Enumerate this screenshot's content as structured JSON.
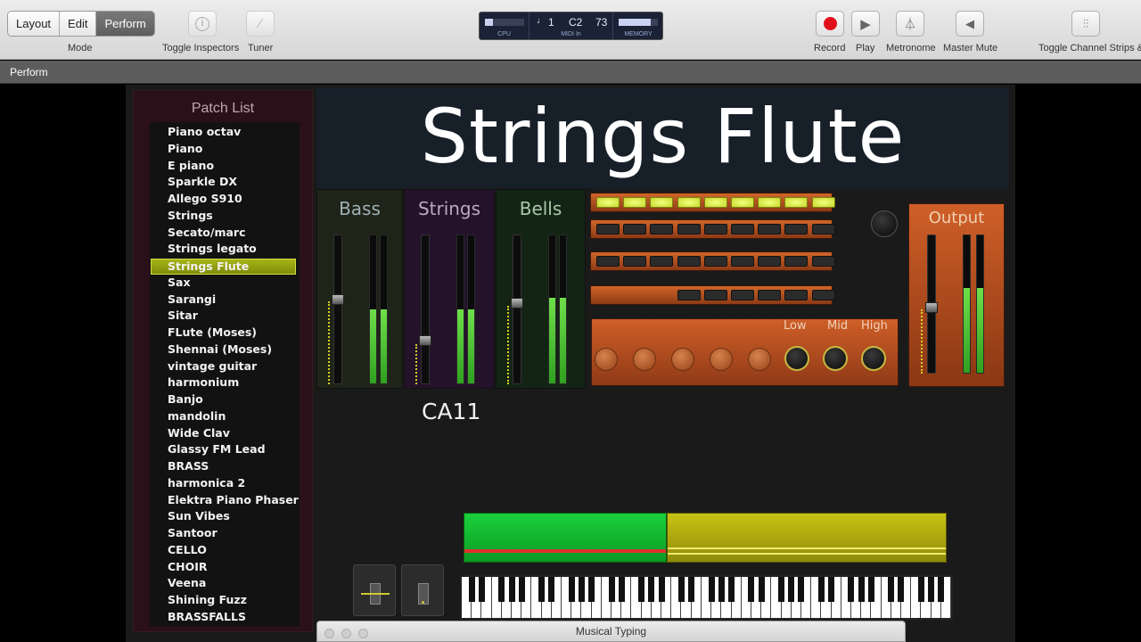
{
  "toolbar": {
    "mode_tabs": [
      "Layout",
      "Edit",
      "Perform"
    ],
    "active_mode": "Perform",
    "mode_label": "Mode",
    "toggle_inspectors_label": "Toggle Inspectors",
    "tuner_label": "Tuner",
    "record_label": "Record",
    "play_label": "Play",
    "metronome_label": "Metronome",
    "master_mute_label": "Master Mute",
    "toggle_channel_strips_label": "Toggle Channel Strips &"
  },
  "lcd": {
    "cpu_label": "CPU",
    "midi_channel": "1",
    "midi_note": "C2",
    "midi_velocity": "73",
    "midi_label": "MIDI In",
    "memory_label": "MEMORY"
  },
  "subbar": {
    "title": "Perform"
  },
  "patch_list": {
    "header": "Patch List",
    "items": [
      "Piano octav",
      "Piano",
      "E piano",
      "Sparkle DX",
      "Allego S910",
      "Strings",
      "Secato/marc",
      "Strings legato",
      "Strings Flute",
      "Sax",
      "Sarangi",
      "Sitar",
      "FLute (Moses)",
      "Shennai (Moses)",
      "vintage guitar",
      "harmonium",
      "Banjo",
      "mandolin",
      "Wide Clav",
      "Glassy FM Lead",
      "BRASS",
      "harmonica 2",
      "Elektra Piano Phaser",
      "Sun Vibes",
      "Santoor",
      "CELLO",
      "CHOIR",
      "Veena",
      "Shining Fuzz",
      "BRASSFALLS"
    ],
    "selected": "Strings Flute"
  },
  "patch_title": "Strings Flute",
  "strips": [
    {
      "name": "Bass",
      "color": "#9eb0b8",
      "fader_level": 0.58,
      "meter_level": 0.5
    },
    {
      "name": "Strings",
      "color": "#b8a8c0",
      "fader_level": 0.28,
      "meter_level": 0.5
    },
    {
      "name": "Bells",
      "color": "#a8c8a8",
      "fader_level": 0.55,
      "meter_level": 0.58
    }
  ],
  "ca_label": "CA11",
  "eq": {
    "low_label": "Low",
    "mid_label": "Mid",
    "high_label": "High"
  },
  "output": {
    "name": "Output",
    "fader_level": 0.48,
    "meter_level": 0.62
  },
  "colors": {
    "accent_selected": "#a7b415",
    "zone_left": "#22c93a",
    "zone_right": "#b5b20f",
    "record": "#e0101a"
  },
  "musical_typing": {
    "title": "Musical Typing"
  },
  "icons": [
    "info-icon",
    "tuner-icon",
    "record-icon",
    "play-icon",
    "metronome-icon",
    "speaker-icon",
    "mixer-icon"
  ]
}
